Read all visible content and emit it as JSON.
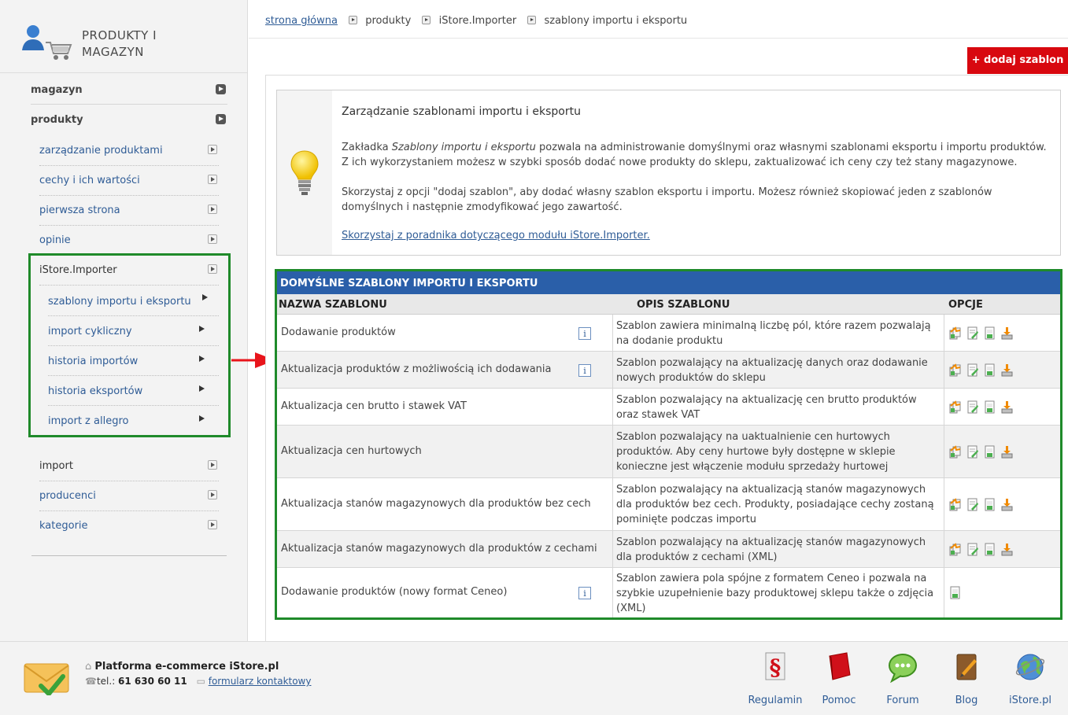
{
  "sidebar": {
    "title_line1": "PRODUKTY I",
    "title_line2": "MAGAZYN",
    "top_items": [
      "magazyn",
      "produkty"
    ],
    "sub_items": [
      "zarządzanie produktami",
      "cechy i ich wartości",
      "pierwsza strona",
      "opinie",
      "iStore.Importer"
    ],
    "importer_items": [
      "szablony importu i eksportu",
      "import cykliczny",
      "historia importów",
      "historia eksportów",
      "import z allegro"
    ],
    "bottom_items": [
      "import",
      "producenci",
      "kategorie"
    ]
  },
  "breadcrumb": {
    "home": "strona główna",
    "items": [
      "produkty",
      "iStore.Importer",
      "szablony importu i eksportu"
    ]
  },
  "add_button": "+ dodaj szablon",
  "info": {
    "title": "Zarządzanie szablonami importu i eksportu",
    "p1_pre": "Zakładka ",
    "p1_em": "Szablony importu i eksportu",
    "p1_post": " pozwala na administrowanie domyślnymi oraz własnymi szablonami eksportu i importu produktów. Z ich wykorzystaniem możesz w szybki sposób dodać nowe produkty do sklepu, zaktualizować ich ceny czy też stany magazynowe.",
    "p2": "Skorzystaj z opcji \"dodaj szablon\", aby dodać własny szablon eksportu i importu. Możesz również skopiować jeden z szablonów domyślnych i następnie zmodyfikować jego zawartość.",
    "link": "Skorzystaj z poradnika dotyczącego modułu iStore.Importer."
  },
  "table": {
    "title": "DOMYŚLNE SZABLONY IMPORTU I EKSPORTU",
    "columns": [
      "NAZWA SZABLONU",
      "OPIS SZABLONU",
      "OPCJE"
    ],
    "info_icon": "i",
    "rows": [
      {
        "name": "Dodawanie produktów",
        "desc": "Szablon zawiera minimalną liczbę pól, które razem pozwalają na dodanie produktu",
        "info": true,
        "options": 4
      },
      {
        "name": "Aktualizacja produktów z możliwością ich dodawania",
        "desc": "Szablon pozwalający na aktualizację danych oraz dodawanie nowych produktów do sklepu",
        "info": true,
        "options": 4
      },
      {
        "name": "Aktualizacja cen brutto i stawek VAT",
        "desc": "Szablon pozwalający na aktualizację cen brutto produktów oraz stawek VAT",
        "info": false,
        "options": 4
      },
      {
        "name": "Aktualizacja cen hurtowych",
        "desc": "Szablon pozwalający na uaktualnienie cen hurtowych produktów. Aby ceny hurtowe były dostępne w sklepie konieczne jest włączenie modułu sprzedaży hurtowej",
        "info": false,
        "options": 4
      },
      {
        "name": "Aktualizacja stanów magazynowych dla produktów bez cech",
        "desc": "Szablon pozwalający na aktualizacją stanów magazynowych dla produktów bez cech. Produkty, posiadające cechy zostaną pominięte podczas importu",
        "info": false,
        "options": 4
      },
      {
        "name": "Aktualizacja stanów magazynowych dla produktów z cechami",
        "desc": "Szablon pozwalający na aktualizację stanów magazynowych dla produktów z cechami (XML)",
        "info": false,
        "options": 4
      },
      {
        "name": "Dodawanie produktów (nowy format Ceneo)",
        "desc": "Szablon zawiera pola spójne z formatem Ceneo i pozwala na szybkie uzupełnienie bazy produktowej sklepu także o zdjęcia (XML)",
        "info": true,
        "options": 1
      }
    ]
  },
  "footer": {
    "company": "Platforma e-commerce iStore.pl",
    "tel_label": "tel.: ",
    "tel": "61 630 60 11",
    "form_link": "formularz kontaktowy",
    "links": [
      "Regulamin",
      "Pomoc",
      "Forum",
      "Blog",
      "iStore.pl"
    ],
    "colors": {
      "accent_red": "#d8080f",
      "header_blue": "#2a5fa9",
      "highlight_green": "#1f8a2a"
    }
  }
}
